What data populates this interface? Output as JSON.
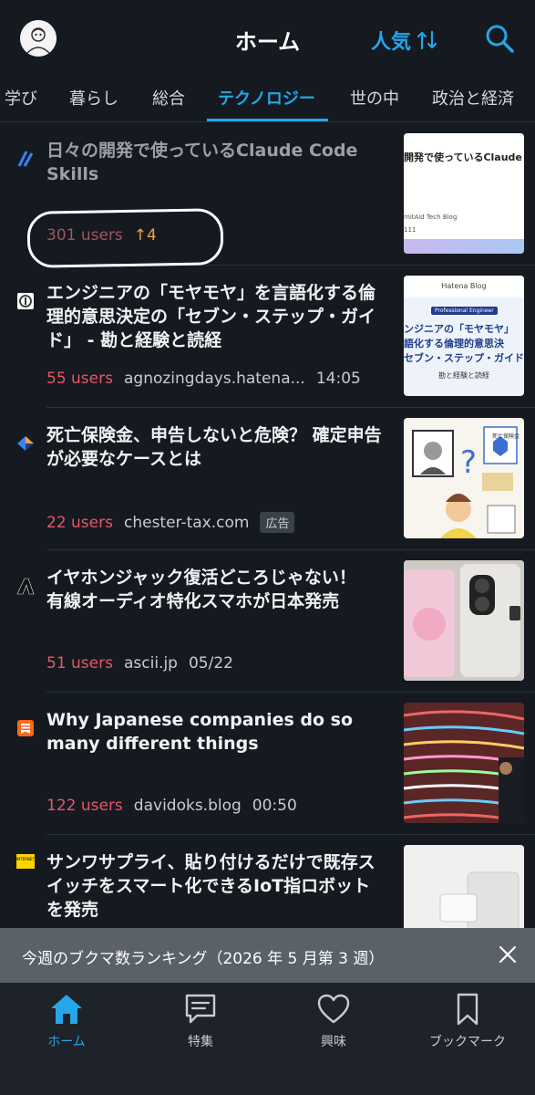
{
  "header": {
    "title": "ホーム",
    "sort_label": "人気",
    "sort_icon": "sort-arrows-icon",
    "search_icon": "search-icon"
  },
  "tabs": [
    {
      "label": "学び"
    },
    {
      "label": "暮らし"
    },
    {
      "label": "総合"
    },
    {
      "label": "テクノロジー",
      "active": true
    },
    {
      "label": "世の中"
    },
    {
      "label": "政治と経済"
    }
  ],
  "entries": [
    {
      "title": "日々の開発で使っているClaude Code Skills",
      "users": "301 users",
      "trend": "↑4",
      "read": true,
      "thumb_text_1": "開発で使っているClaude C",
      "thumb_text_2": "mitAid Tech Blog",
      "thumb_text_3": "111"
    },
    {
      "title": "エンジニアの「モヤモヤ」を言語化する倫理的意思決定の「セブン・ステップ・ガイド」 - 勘と経験と読経",
      "users": "55 users",
      "domain": "agnozingdays.hatena...",
      "time": "14:05",
      "thumb_blog": "Hatena Blog",
      "thumb_badge": "Professional Engineer",
      "thumb_line_1": "ンジニアの「モヤモヤ」",
      "thumb_line_2": "語化する倫理的意思決",
      "thumb_line_3": "セブン・ステップ・ガイド",
      "thumb_footer": "勘と経験と読経"
    },
    {
      "title": "死亡保険金、申告しないと危険？ 確定申告が必要なケースとは",
      "users": "22 users",
      "domain": "chester-tax.com",
      "ad": "広告",
      "thumb_label": "死亡保険金"
    },
    {
      "title": "イヤホンジャック復活どころじゃない！　有線オーディオ特化スマホが日本発売",
      "users": "51 users",
      "domain": "ascii.jp",
      "time": "05/22"
    },
    {
      "title": "Why Japanese companies do so many different things",
      "users": "122 users",
      "domain": "davidoks.blog",
      "time": "00:50"
    },
    {
      "title": "サンワサプライ、貼り付けるだけで既存スイッチをスマート化できるIoT指ロボットを発売",
      "favicon_text": "INTERNET Watch"
    }
  ],
  "banner": {
    "text": "今週のブクマ数ランキング（2026 年 5 月第 3 週）"
  },
  "bottom_nav": [
    {
      "label": "ホーム",
      "icon": "home-icon",
      "active": true
    },
    {
      "label": "特集",
      "icon": "chat-bubble-icon"
    },
    {
      "label": "興味",
      "icon": "heart-icon"
    },
    {
      "label": "ブックマーク",
      "icon": "bookmark-icon"
    }
  ],
  "colors": {
    "accent": "#25a6e8",
    "users": "#e8566a",
    "background": "#141a20"
  }
}
